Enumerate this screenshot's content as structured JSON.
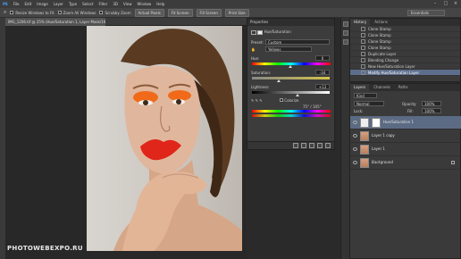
{
  "menu": [
    "PS",
    "File",
    "Edit",
    "Image",
    "Layer",
    "Type",
    "Select",
    "Filter",
    "3D",
    "View",
    "Window",
    "Help"
  ],
  "options": {
    "resize_windows": "Resize Windows to Fit",
    "zoom_all": "Zoom All Windows",
    "scrubby": "Scrubby Zoom",
    "actual_pixels": "Actual Pixels",
    "fit_screen": "Fit Screen",
    "fill_screen": "Fill Screen",
    "print_size": "Print Size",
    "workspace": "Essentials"
  },
  "document": {
    "tab_title": "IMG_1206.tif @ 25% (Hue/Saturation 1, Layer Mask/16) *"
  },
  "watermark": "PHOTOWEBEXPO.RU",
  "properties": {
    "panel_title": "Properties",
    "adjustment_title": "Hue/Saturation",
    "preset_label": "Preset:",
    "preset_value": "Custom",
    "channel_value": "Yellows",
    "hue_label": "Hue:",
    "hue_value": "0",
    "saturation_label": "Saturation:",
    "saturation_value": "-34",
    "lightness_label": "Lightness:",
    "lightness_value": "+13",
    "colorize_label": "Colorize",
    "range_readout": "75° / 105°"
  },
  "history": {
    "tabs": [
      "History",
      "Actions"
    ],
    "items": [
      "Clone Stamp",
      "Clone Stamp",
      "Clone Stamp",
      "Clone Stamp",
      "Duplicate Layer",
      "Blending Change",
      "New Hue/Saturation Layer",
      "Modify Hue/Saturation Layer"
    ]
  },
  "layers": {
    "tabs": [
      "Layers",
      "Channels",
      "Paths"
    ],
    "kind_label": "Kind",
    "blend_mode": "Normal",
    "opacity_label": "Opacity:",
    "opacity_value": "100%",
    "lock_label": "Lock:",
    "fill_label": "Fill:",
    "fill_value": "100%",
    "items": [
      "Hue/Saturation 1",
      "Layer 1 copy",
      "Layer 1",
      "Background"
    ]
  },
  "colors": {
    "accent": "#5d6e8c",
    "ui_bg": "#3a3a3a"
  },
  "icons": [
    "eye-icon",
    "lock-icon",
    "eyedropper-icon",
    "hand-icon"
  ]
}
